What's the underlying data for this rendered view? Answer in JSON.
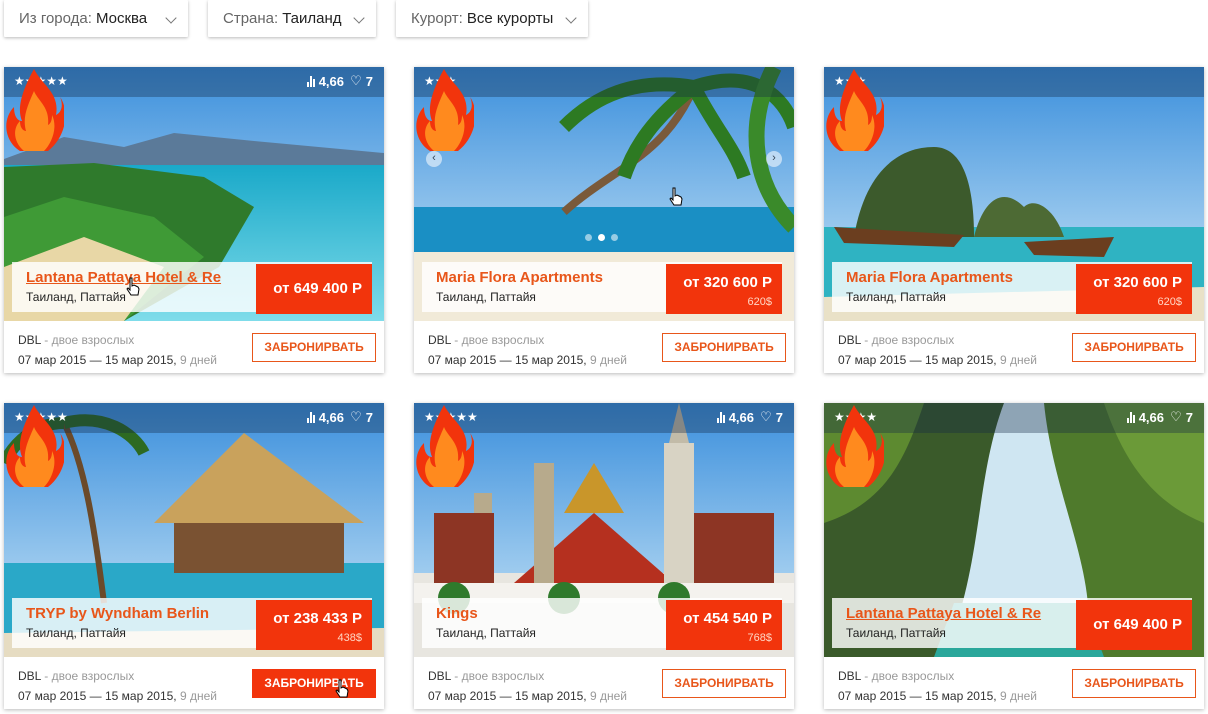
{
  "filters": [
    {
      "label": "Из города:",
      "value": "Москва"
    },
    {
      "label": "Страна:",
      "value": "Таиланд"
    },
    {
      "label": "Курорт:",
      "value": "Все курорты"
    }
  ],
  "star_glyph": "★",
  "cards": [
    {
      "stars": "★★★★★",
      "rating": "4,66",
      "likes": "7",
      "name": "Lantana Pattaya Hotel & Re",
      "location": "Таиланд, Паттайя",
      "price": "от 649 400 Р",
      "price_usd": "",
      "room": "DBL",
      "guests": " - двое взрослых",
      "dates": "07 мар 2015 — 15 мар 2015,",
      "nights": " 9 дней",
      "button": "ЗАБРОНИРВАТЬ"
    },
    {
      "stars": "★★★",
      "rating": "",
      "likes": "",
      "name": "Maria Flora Apartments",
      "location": "Таиланд, Паттайя",
      "price": "от 320 600 Р",
      "price_usd": "620$",
      "room": "DBL",
      "guests": " - двое взрослых",
      "dates": "07 мар 2015 — 15 мар 2015,",
      "nights": " 9 дней",
      "button": "ЗАБРОНИРВАТЬ",
      "prev_arrow": "‹",
      "next_arrow": "›"
    },
    {
      "stars": "★★★",
      "rating": "",
      "likes": "",
      "name": "Maria Flora Apartments",
      "location": "Таиланд, Паттайя",
      "price": "от 320 600 Р",
      "price_usd": "620$",
      "room": "DBL",
      "guests": " - двое взрослых",
      "dates": "07 мар 2015 — 15 мар 2015,",
      "nights": " 9 дней",
      "button": "ЗАБРОНИРВАТЬ"
    },
    {
      "stars": "★★★★★",
      "rating": "4,66",
      "likes": "7",
      "name": "TRYP by Wyndham Berlin",
      "location": "Таиланд, Паттайя",
      "price": "от 238 433 Р",
      "price_usd": "438$",
      "room": "DBL",
      "guests": " - двое взрослых",
      "dates": "07 мар 2015 — 15 мар 2015,",
      "nights": " 9 дней",
      "button": "ЗАБРОНИРВАТЬ"
    },
    {
      "stars": "★★★★★",
      "rating": "4,66",
      "likes": "7",
      "name": "Kings",
      "location": "Таиланд, Паттайя",
      "price": "от 454 540 Р",
      "price_usd": "768$",
      "room": "DBL",
      "guests": " - двое взрослых",
      "dates": "07 мар 2015 — 15 мар 2015,",
      "nights": " 9 дней",
      "button": "ЗАБРОНИРВАТЬ"
    },
    {
      "stars": "★★★★",
      "rating": "4,66",
      "likes": "7",
      "name": "Lantana Pattaya Hotel & Re",
      "location": "Таиланд, Паттайя",
      "price": "от 649 400 Р",
      "price_usd": "",
      "room": "DBL",
      "guests": " - двое взрослых",
      "dates": "07 мар 2015 — 15 мар 2015,",
      "nights": " 9 дней",
      "button": "ЗАБРОНИРВАТЬ"
    }
  ],
  "colors": {
    "accent": "#e8561a",
    "price_bg": "#f2340c",
    "flame_outer": "#f2340c",
    "flame_inner": "#ff8a1e"
  }
}
